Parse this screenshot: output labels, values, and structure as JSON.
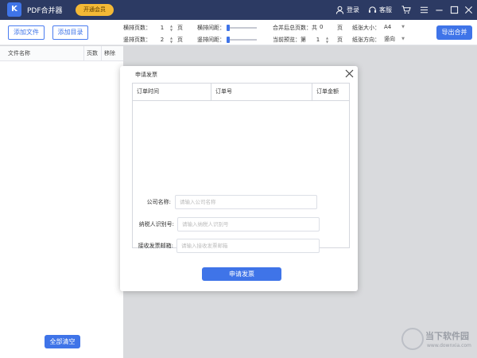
{
  "app": {
    "logo_text": "K",
    "title": "PDF合并器",
    "vip_label": "开通会员",
    "login_label": "登录",
    "service_label": "客服"
  },
  "toolbar": {
    "add_file_label": "添加文件",
    "add_dir_label": "添加目录",
    "h_pages_label": "横排页数：",
    "h_pages_value": "1",
    "v_pages_label": "竖排页数：",
    "v_pages_value": "2",
    "page_unit": "页",
    "h_gap_label": "横排间距：",
    "v_gap_label": "竖排间距：",
    "h_gap_value": 0,
    "v_gap_value": 0,
    "total_label": "合并后总页数：共",
    "total_value": "0",
    "preview_label": "当前预览：第",
    "preview_value": "1",
    "paper_size_label": "纸张大小：",
    "paper_size_value": "A4",
    "paper_dir_label": "纸张方向：",
    "paper_dir_value": "竖向",
    "export_label": "导出合并"
  },
  "file_list": {
    "columns": [
      "文件名称",
      "页数",
      "移除"
    ],
    "clear_all_label": "全部清空"
  },
  "dialog": {
    "title": "申请发票",
    "table_columns": [
      "订单时间",
      "订单号",
      "订单金额"
    ],
    "company_label": "公司名称:",
    "company_placeholder": "请输入公司名称",
    "taxid_label": "纳税人识别号:",
    "taxid_placeholder": "请输入纳税人识别号",
    "email_label": "接收发票邮箱:",
    "email_placeholder": "请输入接收发票邮箱",
    "submit_label": "申请发票"
  },
  "watermark": {
    "line1": "当下软件园",
    "line2": "www.downxia.com"
  },
  "colors": {
    "titlebar": "#2c3a63",
    "accent": "#3f74e8",
    "vip": "#f4b936"
  }
}
